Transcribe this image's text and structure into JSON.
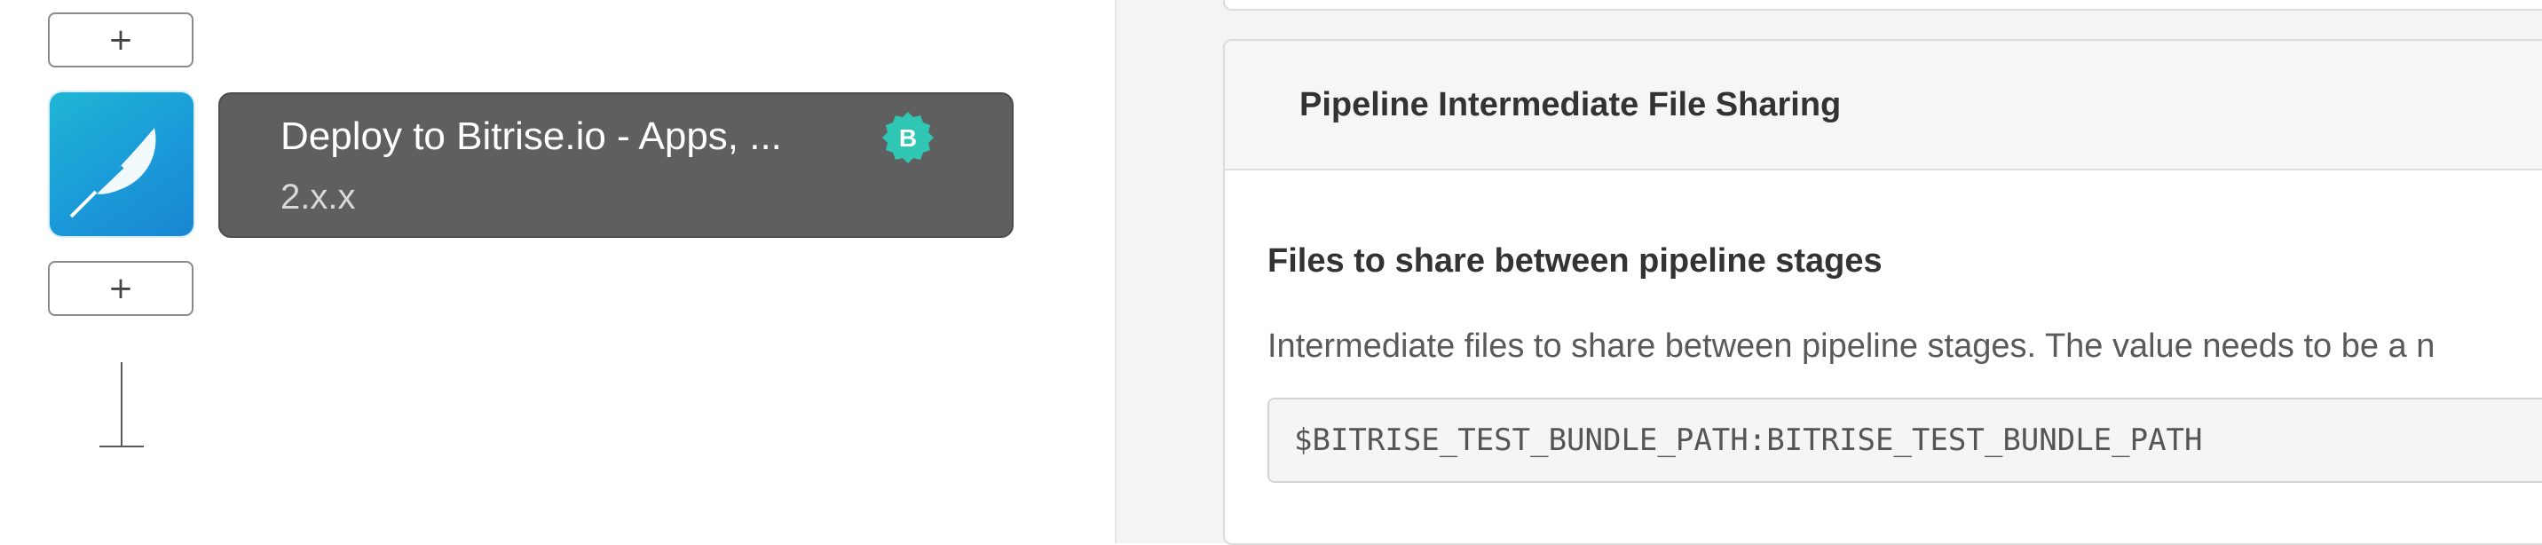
{
  "workflow_editor": {
    "add_step_label": "+",
    "step": {
      "title": "Deploy to Bitrise.io - Apps, ...",
      "version": "2.x.x",
      "badge_letter": "B",
      "icon": "rocket-feather-icon",
      "badge_icon": "verified-badge-icon",
      "colors": {
        "card_bg": "#5f5f5f",
        "icon_bg": "#1a9ad8",
        "badge": "#2fc7b3"
      }
    }
  },
  "inputs_panel": {
    "section_title": "Pipeline Intermediate File Sharing",
    "field": {
      "label": "Files to share between pipeline stages",
      "description": "Intermediate files to share between pipeline stages. The value needs to be a n",
      "value": "$BITRISE_TEST_BUNDLE_PATH:BITRISE_TEST_BUNDLE_PATH"
    }
  }
}
